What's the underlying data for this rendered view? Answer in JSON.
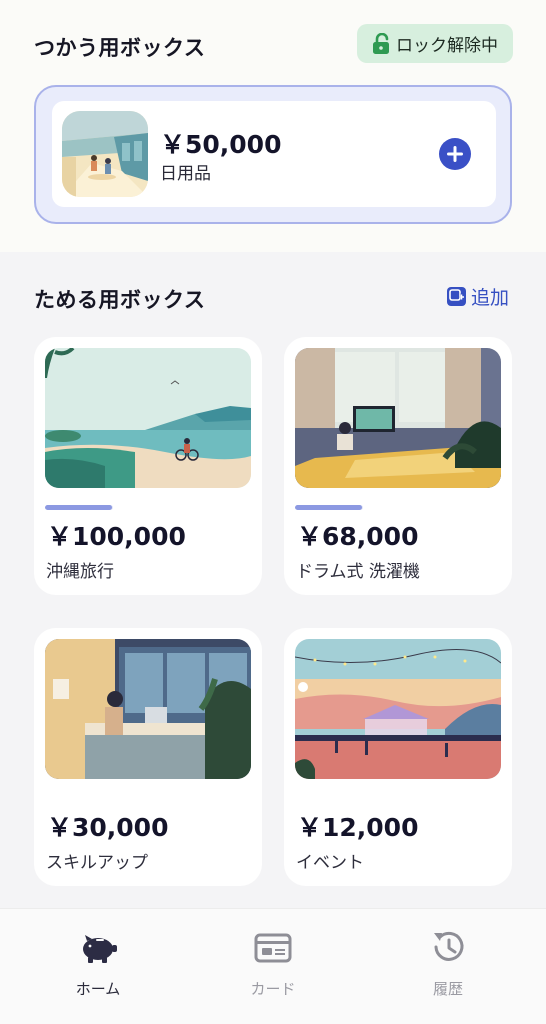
{
  "spend": {
    "title": "つかう用ボックス",
    "lock_status": "ロック解除中",
    "box": {
      "amount": "￥50,000",
      "label": "日用品"
    }
  },
  "save": {
    "title": "ためる用ボックス",
    "add_label": "追加",
    "boxes": [
      {
        "amount": "￥100,000",
        "label": "沖縄旅行",
        "progress": 0.33,
        "image": "beach-cyclist"
      },
      {
        "amount": "￥68,000",
        "label": "ドラム式 洗濯機",
        "progress": 0.33,
        "image": "living-room"
      },
      {
        "amount": "￥30,000",
        "label": "スキルアップ",
        "image": "office-desk"
      },
      {
        "amount": "￥12,000",
        "label": "イベント",
        "image": "festival"
      }
    ]
  },
  "tabs": [
    {
      "label": "ホーム",
      "icon": "piggy-bank-icon",
      "active": true
    },
    {
      "label": "カード",
      "icon": "card-icon",
      "active": false
    },
    {
      "label": "履歴",
      "icon": "history-icon",
      "active": false
    }
  ],
  "colors": {
    "accent": "#3a50c6",
    "lock_badge_bg": "#d7efde",
    "lock_icon": "#2f9a52",
    "progress": "#8c99e2"
  }
}
